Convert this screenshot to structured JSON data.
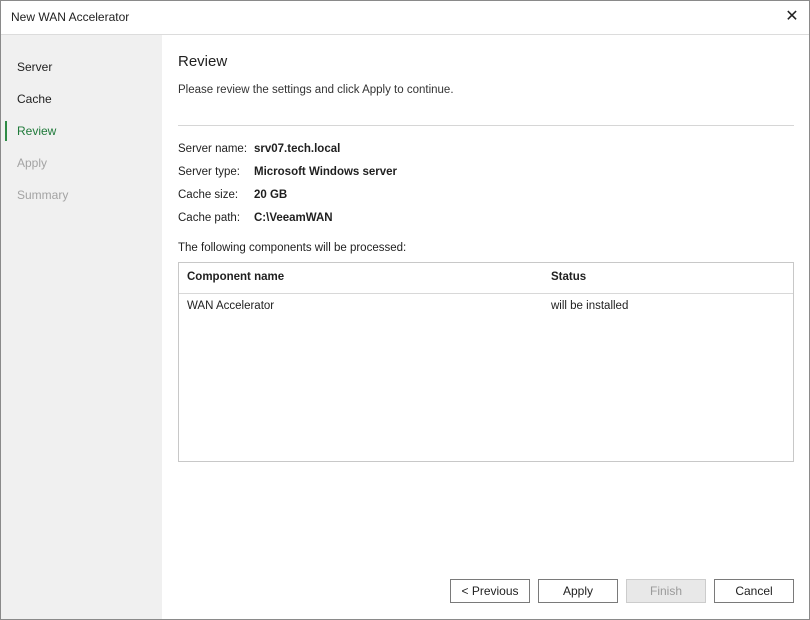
{
  "window": {
    "title": "New WAN Accelerator",
    "close_icon": "✕"
  },
  "steps": [
    {
      "label": "Server",
      "state": "normal"
    },
    {
      "label": "Cache",
      "state": "normal"
    },
    {
      "label": "Review",
      "state": "active"
    },
    {
      "label": "Apply",
      "state": "disabled"
    },
    {
      "label": "Summary",
      "state": "disabled"
    }
  ],
  "page": {
    "title": "Review",
    "description": "Please review the settings and click Apply to continue."
  },
  "summary": [
    {
      "key": "Server name:",
      "value": "srv07.tech.local"
    },
    {
      "key": "Server type:",
      "value": "Microsoft Windows server"
    },
    {
      "key": "Cache size:",
      "value": "20 GB"
    },
    {
      "key": "Cache path:",
      "value": "C:\\VeeamWAN"
    }
  ],
  "components": {
    "caption": "The following components will be processed:",
    "columns": [
      "Component name",
      "Status"
    ],
    "rows": [
      {
        "name": "WAN Accelerator",
        "status": "will be installed"
      }
    ]
  },
  "buttons": {
    "previous": "< Previous",
    "apply": "Apply",
    "finish": "Finish",
    "cancel": "Cancel"
  },
  "colors": {
    "accent": "#2e8b45",
    "sidebar_bg": "#f0f0f0"
  }
}
